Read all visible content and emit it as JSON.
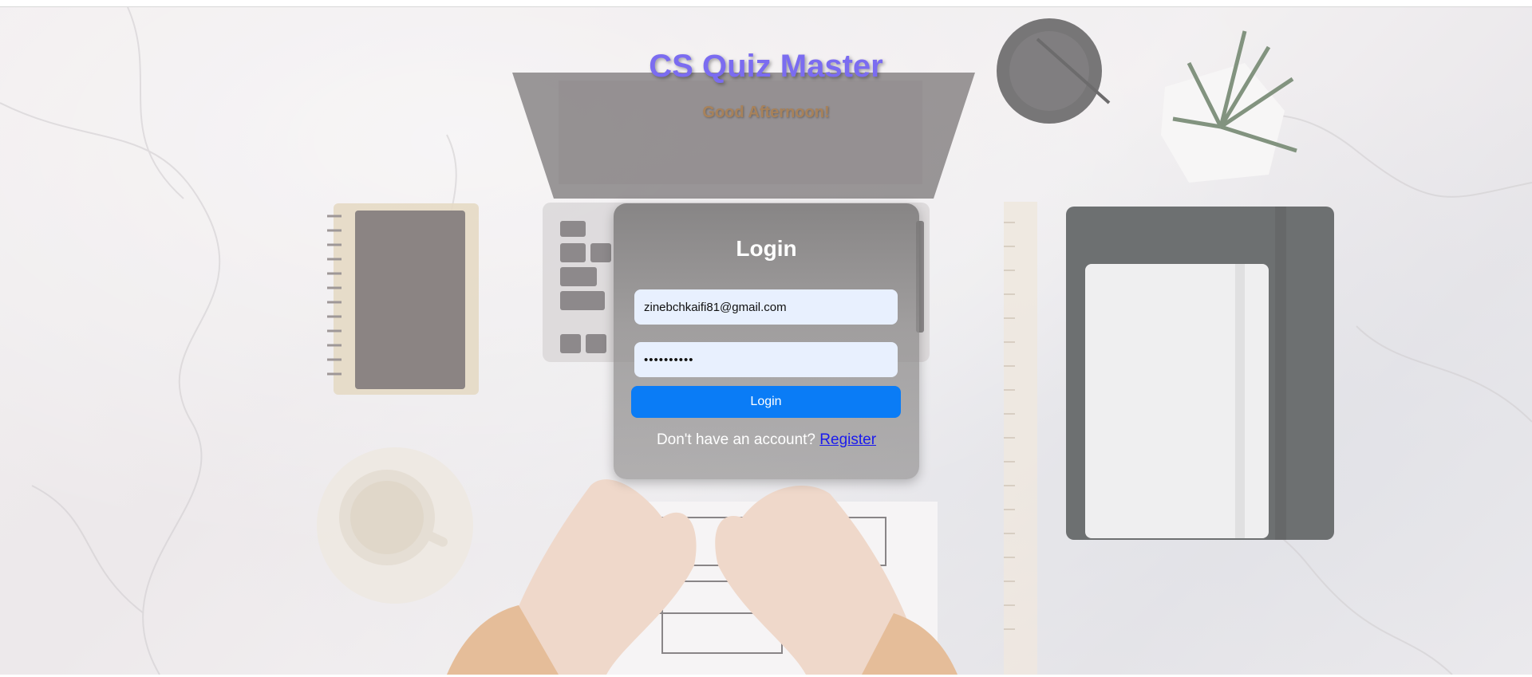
{
  "header": {
    "title": "CS Quiz Master",
    "greeting": "Good Afternoon!"
  },
  "login": {
    "heading": "Login",
    "email_value": "zinebchkaifi81@gmail.com",
    "password_value": "••••••••••",
    "button_label": "Login",
    "register_prompt": "Don't have an account?",
    "register_link": "Register"
  },
  "colors": {
    "title": "#7b6cf0",
    "greeting": "#a8825a",
    "button": "#0a7cf6",
    "input_bg": "#e8f0fe",
    "link": "#1a1aee"
  }
}
